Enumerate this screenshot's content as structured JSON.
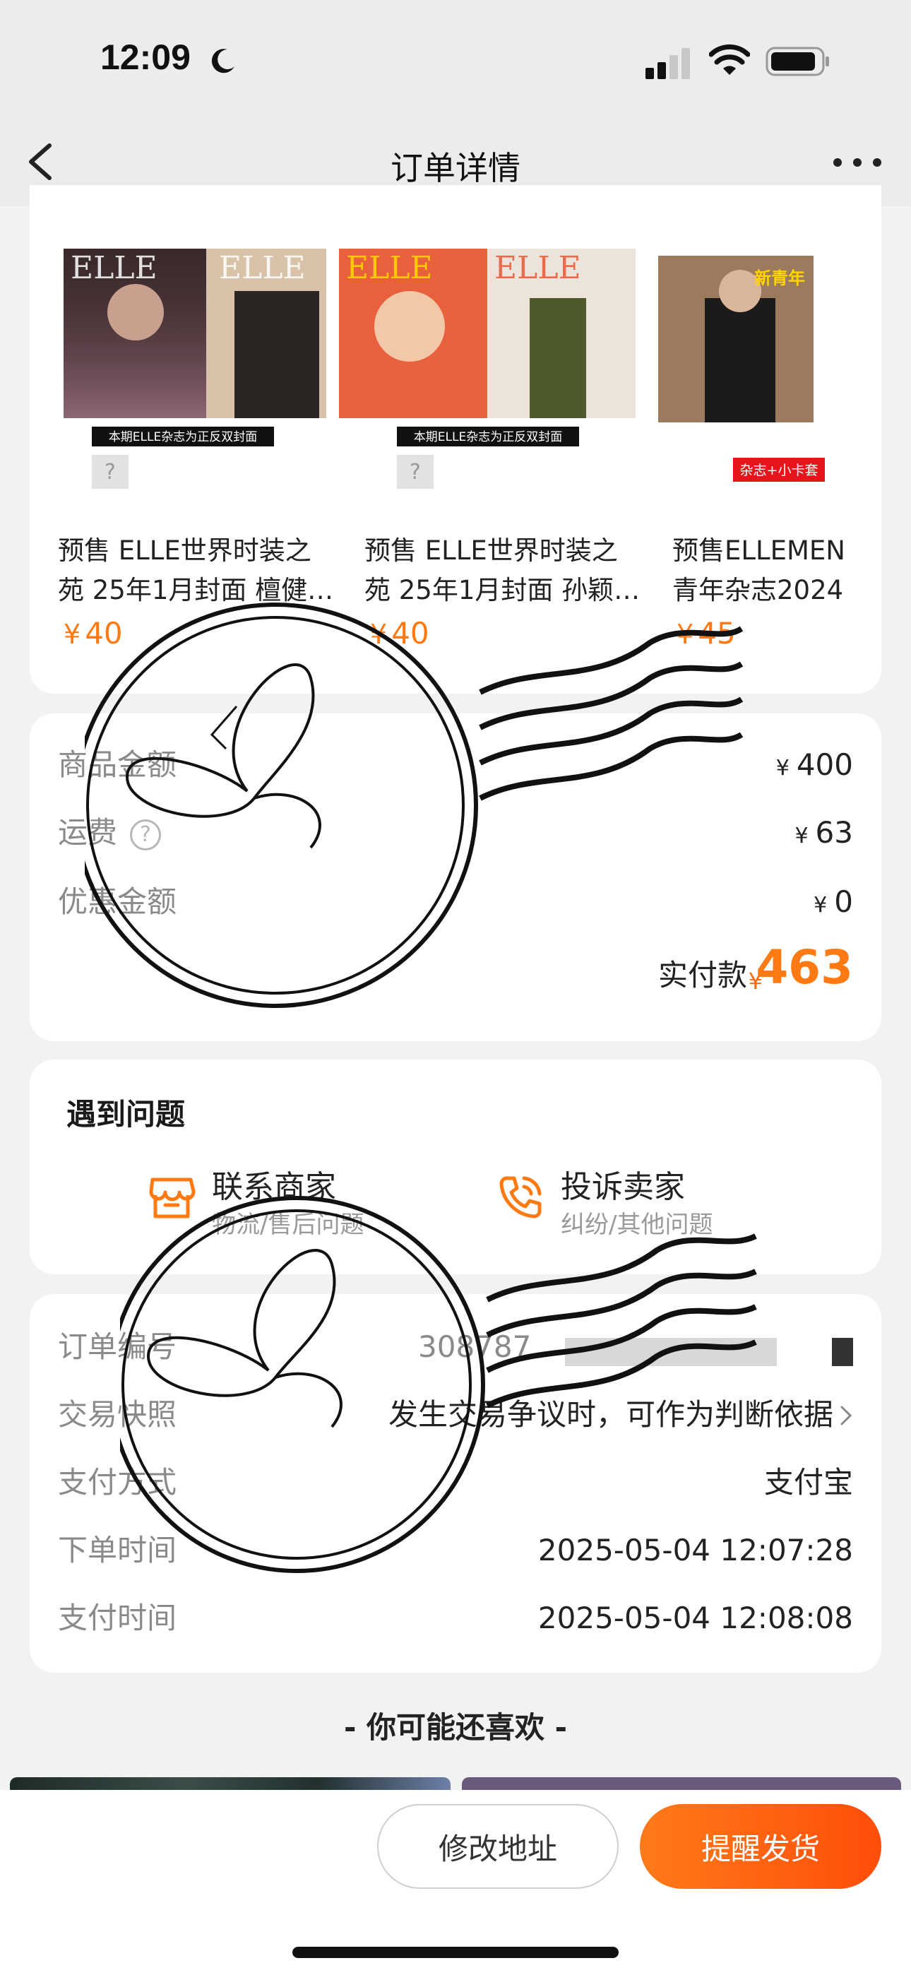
{
  "status_bar": {
    "time": "12:09"
  },
  "nav": {
    "title": "订单详情"
  },
  "products": [
    {
      "name_line1": "预售 ELLE世界时装之",
      "name_line2": "苑 25年1月封面 檀健…",
      "price_symbol": "¥",
      "price": "40",
      "banner": "本期ELLE杂志为正反双封面"
    },
    {
      "name_line1": "预售 ELLE世界时装之",
      "name_line2": "苑 25年1月封面 孙颖…",
      "price_symbol": "¥",
      "price": "40",
      "banner": "本期ELLE杂志为正反双封面"
    },
    {
      "name_line1": "预售ELLEMEN",
      "name_line2": "青年杂志2024",
      "price_symbol": "¥",
      "price": "45",
      "tag": "杂志+小卡套"
    }
  ],
  "amounts": {
    "goods_label": "商品金额",
    "goods_value": "400",
    "shipping_label": "运费",
    "shipping_value": "63",
    "discount_label": "优惠金额",
    "discount_value": "0",
    "yen": "¥",
    "total_label": "实付款",
    "total_value": "463"
  },
  "problem": {
    "title": "遇到问题",
    "contact_title": "联系商家",
    "contact_sub": "物流/售后问题",
    "complain_title": "投诉卖家",
    "complain_sub": "纠纷/其他问题"
  },
  "order_info": {
    "number_label": "订单编号",
    "number_value": "308787",
    "snapshot_label": "交易快照",
    "snapshot_value": "发生交易争议时，可作为判断依据",
    "payment_label": "支付方式",
    "payment_value": "支付宝",
    "order_time_label": "下单时间",
    "order_time_value": "2025-05-04 12:07:28",
    "pay_time_label": "支付时间",
    "pay_time_value": "2025-05-04 12:08:08"
  },
  "recommend": {
    "title": "- 你可能还喜欢 -"
  },
  "actions": {
    "modify_address": "修改地址",
    "remind_ship": "提醒发货"
  },
  "colors": {
    "accent": "#ff7a12",
    "background": "#f2f2f2",
    "card": "#ffffff"
  }
}
